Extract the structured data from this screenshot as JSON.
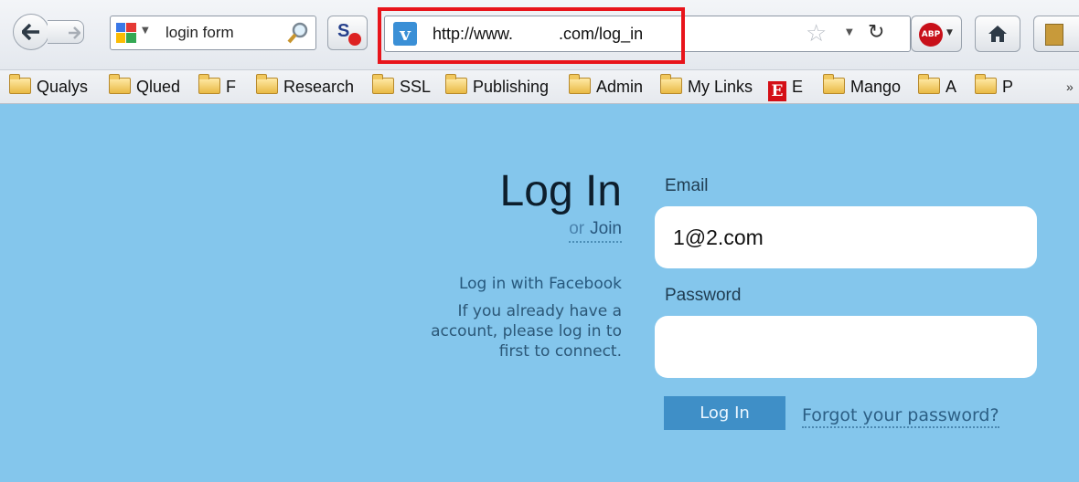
{
  "search": {
    "value": "login form",
    "engine_icon": "google-icon"
  },
  "address_bar": {
    "url": "http://www.          .com/log_in",
    "site_icon_letter": "v"
  },
  "toolbar": {
    "abp_label": "ABP"
  },
  "bookmarks": {
    "items": [
      {
        "label": "Qualys",
        "icon": "folder"
      },
      {
        "label": "Qlued",
        "icon": "folder"
      },
      {
        "label": "F",
        "icon": "folder"
      },
      {
        "label": "Research",
        "icon": "folder"
      },
      {
        "label": "SSL",
        "icon": "folder"
      },
      {
        "label": "Publishing",
        "icon": "folder"
      },
      {
        "label": "Admin",
        "icon": "folder"
      },
      {
        "label": "My Links",
        "icon": "folder"
      },
      {
        "label": "E",
        "icon": "e-icon",
        "icon_text": "E"
      },
      {
        "label": "Mango",
        "icon": "folder"
      },
      {
        "label": "A",
        "icon": "folder"
      },
      {
        "label": "P",
        "icon": "folder"
      }
    ],
    "more": "»"
  },
  "login": {
    "heading": "Log In",
    "or_text": "or",
    "join_label": "Join",
    "facebook_link": "Log in with Facebook",
    "facebook_note": [
      "If you already have a",
      "account, please log in to",
      "first to connect."
    ],
    "email_label": "Email",
    "email_value": "1@2.com",
    "password_label": "Password",
    "password_value": "",
    "submit_label": "Log In",
    "forgot_label": "Forgot your password?"
  },
  "colors": {
    "page_bg": "#84c6ec",
    "button_bg": "#3f8fc7",
    "highlight": "#e8141b"
  }
}
